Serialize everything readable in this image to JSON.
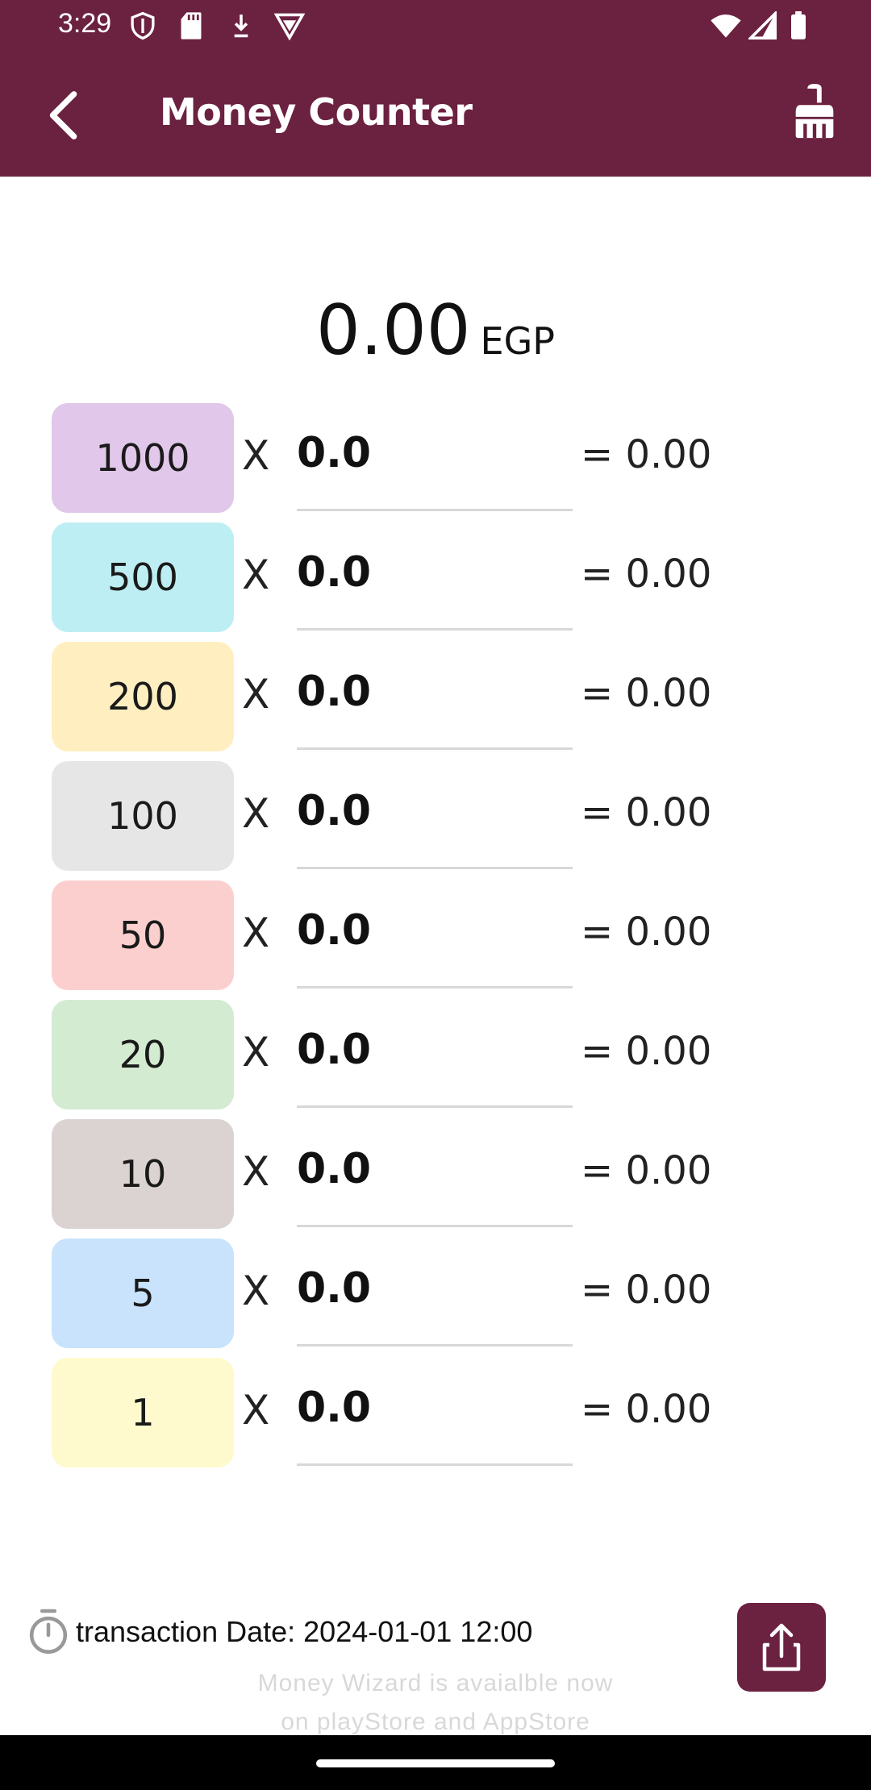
{
  "status_bar": {
    "time": "3:29",
    "icons": [
      "shield-icon",
      "sd-card-icon",
      "download-icon",
      "vpn-icon",
      "wifi-icon",
      "signal-icon",
      "battery-icon"
    ]
  },
  "app_bar": {
    "title": "Money Counter",
    "back_icon": "arrow-back-icon",
    "action_icon": "broom-icon",
    "color": "#6b2140"
  },
  "total": {
    "amount": "0.00",
    "currency": "EGP"
  },
  "rows": [
    {
      "denomination": "1000",
      "times": "X",
      "quantity": "0.0",
      "subtotal": "= 0.00",
      "color": "#e1c7ea"
    },
    {
      "denomination": "500",
      "times": "X",
      "quantity": "0.0",
      "subtotal": "= 0.00",
      "color": "#bdeef4"
    },
    {
      "denomination": "200",
      "times": "X",
      "quantity": "0.0",
      "subtotal": "= 0.00",
      "color": "#ffefc0"
    },
    {
      "denomination": "100",
      "times": "X",
      "quantity": "0.0",
      "subtotal": "= 0.00",
      "color": "#e6e6e6"
    },
    {
      "denomination": "50",
      "times": "X",
      "quantity": "0.0",
      "subtotal": "= 0.00",
      "color": "#fccfcf"
    },
    {
      "denomination": "20",
      "times": "X",
      "quantity": "0.0",
      "subtotal": "= 0.00",
      "color": "#d3ebd1"
    },
    {
      "denomination": "10",
      "times": "X",
      "quantity": "0.0",
      "subtotal": "= 0.00",
      "color": "#dbd3d1"
    },
    {
      "denomination": "5",
      "times": "X",
      "quantity": "0.0",
      "subtotal": "= 0.00",
      "color": "#c8e3fb"
    },
    {
      "denomination": "1",
      "times": "X",
      "quantity": "0.0",
      "subtotal": "= 0.00",
      "color": "#fffacd"
    }
  ],
  "footer": {
    "date_label": "transaction Date: 2024-01-01 12:00",
    "date_icon": "timer-icon",
    "promo_line1": "Money Wizard is avaialble now",
    "promo_line2": "on playStore and AppStore",
    "share_icon": "share-icon"
  }
}
